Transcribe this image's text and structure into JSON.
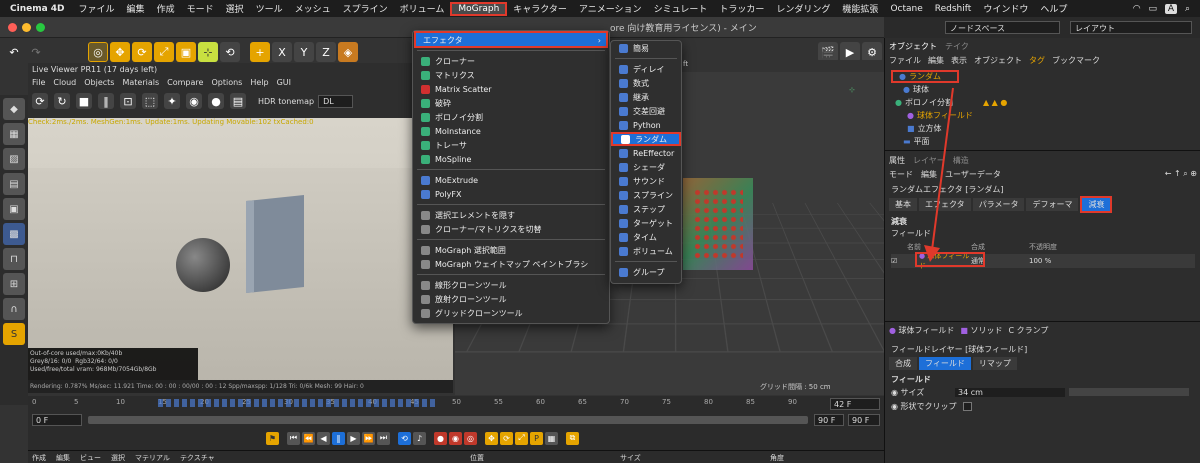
{
  "macmenu": {
    "app": "Cinema 4D",
    "items": [
      "ファイル",
      "編集",
      "作成",
      "モード",
      "選択",
      "ツール",
      "メッシュ",
      "スプライン",
      "ボリューム",
      "MoGraph",
      "キャラクター",
      "アニメーション",
      "シミュレート",
      "トラッカー",
      "レンダリング",
      "機能拡張",
      "Octane",
      "Redshift",
      "ウインドウ",
      "ヘルプ"
    ]
  },
  "topright": {
    "nodespace": "ノードスペース",
    "layout": "レイアウト"
  },
  "window_title": "ore 向け教育用ライセンス) - メイン",
  "liveviewer": {
    "title": "Live Viewer PR11 (17 days left)",
    "menus": [
      "File",
      "Cloud",
      "Objects",
      "Materials",
      "Compare",
      "Options",
      "Help",
      "GUI"
    ],
    "tonemap": "HDR tonemap",
    "channel": "DL",
    "status": "Check:2ms./2ms. MeshGen:1ms. Update:1ms. Updating Movable:102 txCached:0",
    "status2": "Out-of-core used/max:0Kb/40b",
    "grey": "Grey8/16: 0/0",
    "rgb": "Rgb32/64: 0/0",
    "vram": "Used/free/total vram: 968Mb/7054Gb/8Gb",
    "rendering": "Rendering: 0.787%  Ms/sec: 11.921  Time: 00 : 00 : 00/00 : 00 : 12  Spp/maxspp: 1/128  Tri: 0/6k  Mesh: 99  Hair: 0"
  },
  "viewport": {
    "grid": "グリッド間隔 : 50 cm",
    "label": "ft"
  },
  "mograph_menu": {
    "effector": "エフェクタ",
    "items": [
      "クローナー",
      "マトリクス",
      "Matrix Scatter",
      "破砕",
      "ボロノイ分割",
      "MoInstance",
      "トレーサ",
      "MoSpline"
    ],
    "items2": [
      "MoExtrude",
      "PolyFX"
    ],
    "items3": [
      "選択エレメントを隠す",
      "クローナー/マトリクスを切替"
    ],
    "items4": [
      "MoGraph 選択範囲",
      "MoGraph ウェイトマップ ペイントブラシ"
    ],
    "items5": [
      "線形クローンツール",
      "放射クローンツール",
      "グリッドクローンツール"
    ]
  },
  "effector_menu": {
    "items1": [
      "簡易"
    ],
    "items2": [
      "ディレイ",
      "数式",
      "継承",
      "交差回避",
      "Python",
      "ランダム",
      "ReEffector",
      "シェーダ",
      "サウンド",
      "スプライン",
      "ステップ",
      "ターゲット",
      "タイム",
      "ボリューム"
    ],
    "items3": [
      "グループ"
    ]
  },
  "objects": {
    "tabs": [
      "オブジェクト",
      "テイク"
    ],
    "menus": [
      "ファイル",
      "編集",
      "表示",
      "オブジェクト",
      "タグ",
      "ブックマーク"
    ],
    "rows": [
      "ランダム",
      "球体",
      "ボロノイ分割",
      "球体フィールド",
      "立方体",
      "平面"
    ]
  },
  "attributes": {
    "tabs": [
      "属性",
      "レイヤー",
      "構造"
    ],
    "menus": [
      "モード",
      "編集",
      "ユーザーデータ"
    ],
    "title": "ランダムエフェクタ [ランダム]",
    "subtabs": [
      "基本",
      "エフェクタ",
      "パラメータ",
      "デフォーマ",
      "減衰"
    ],
    "section": "減衰",
    "field_label": "フィールド",
    "cols": [
      "名前",
      "合成",
      "不透明度"
    ],
    "row": {
      "name": "球体フィールド",
      "blend": "通常",
      "opacity": "100 %"
    }
  },
  "field": {
    "tabs": [
      "球体フィールド",
      "ソリッド",
      "クランプ"
    ],
    "layer": "フィールドレイヤー [球体フィールド]",
    "subtabs": [
      "合成",
      "フィールド",
      "リマップ"
    ],
    "section": "フィールド",
    "size_label": "サイズ",
    "size": "34 cm",
    "clip_label": "形状でクリップ"
  },
  "timeline": {
    "ticks": [
      "0",
      "5",
      "10",
      "15",
      "20",
      "25",
      "30",
      "35",
      "40",
      "45",
      "50",
      "55",
      "60",
      "65",
      "70",
      "75",
      "80",
      "85",
      "90"
    ],
    "frame": "0 F",
    "start": "0 F",
    "end": "90 F",
    "end2": "90 F",
    "cur": "42 F"
  },
  "bottom": {
    "menus": [
      "作成",
      "編集",
      "ビュー",
      "選択",
      "マテリアル",
      "テクスチャ"
    ],
    "cols": [
      "位置",
      "サイズ",
      "角度"
    ]
  },
  "status_icons": [
    "wifi",
    "battery",
    "A",
    "search"
  ],
  "colors": {
    "red": "#e0392b",
    "blue": "#1d6fd8"
  }
}
